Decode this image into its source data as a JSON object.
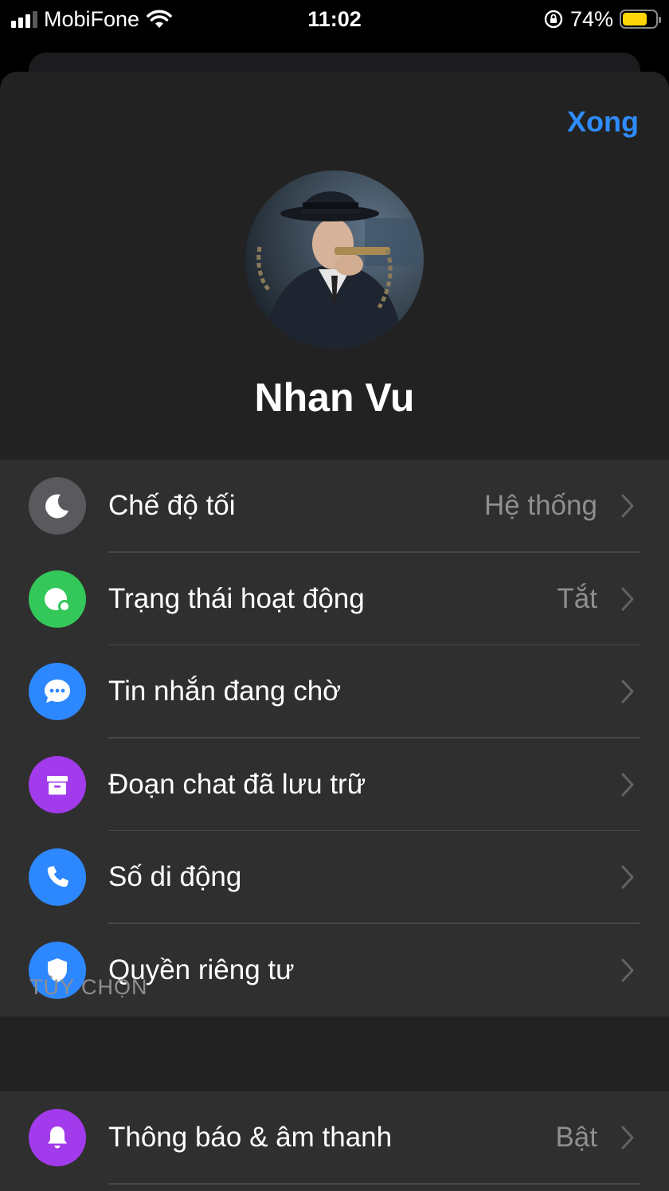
{
  "status_bar": {
    "carrier": "MobiFone",
    "time": "11:02",
    "battery_percent": "74%",
    "battery_level": 0.74,
    "battery_color": "#ffd60a"
  },
  "header": {
    "done_label": "Xong"
  },
  "profile": {
    "name": "Nhan Vu"
  },
  "settings": {
    "items": [
      {
        "label": "Chế độ tối",
        "value": "Hệ thống",
        "icon": "moon-icon",
        "color": "#5a5a5e"
      },
      {
        "label": "Trạng thái hoạt động",
        "value": "Tắt",
        "icon": "active-status-icon",
        "color": "#34c759"
      },
      {
        "label": "Tin nhắn đang chờ",
        "value": "",
        "icon": "message-bubble-icon",
        "color": "#2d88ff"
      },
      {
        "label": "Đoạn chat đã lưu trữ",
        "value": "",
        "icon": "archive-box-icon",
        "color": "#a23bec"
      },
      {
        "label": "Số di động",
        "value": "",
        "icon": "phone-icon",
        "color": "#2d88ff"
      },
      {
        "label": "Quyền riêng tư",
        "value": "",
        "icon": "shield-icon",
        "color": "#2d88ff"
      }
    ]
  },
  "options": {
    "header": "TÙY CHỌN",
    "items": [
      {
        "label": "Thông báo & âm thanh",
        "value": "Bật",
        "icon": "bell-icon",
        "color": "#a23bec"
      }
    ]
  },
  "colors": {
    "accent": "#2f8cff",
    "sheet_background": "#222222",
    "row_background": "#2f2f2f",
    "secondary_text": "#8e8e93"
  }
}
